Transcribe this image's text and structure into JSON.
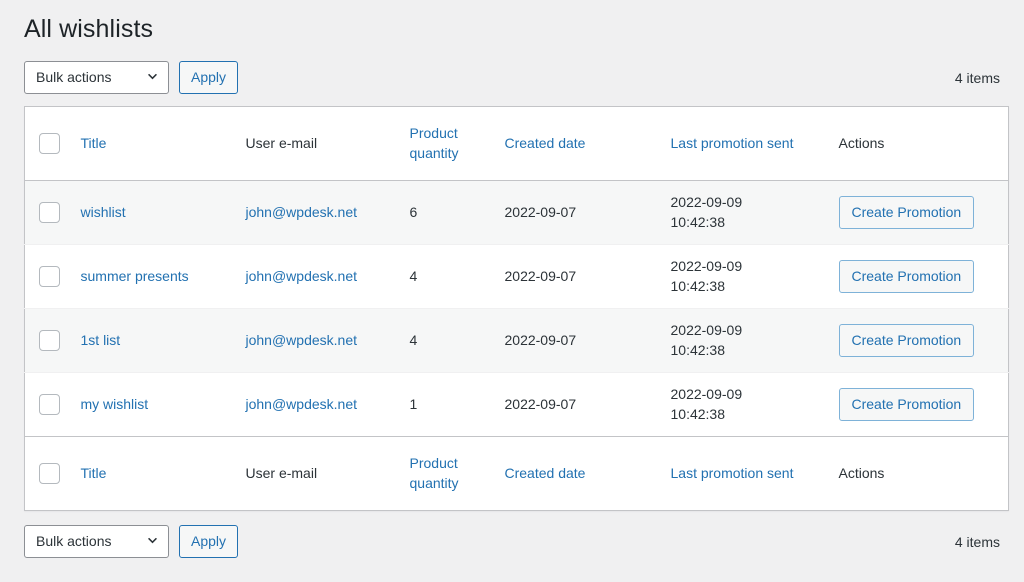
{
  "page": {
    "title": "All wishlists"
  },
  "tablenav": {
    "bulk_actions_label": "Bulk actions",
    "apply_label": "Apply",
    "items_count": "4 items",
    "chevron_icon": "chevron-down-icon"
  },
  "table": {
    "columns": [
      {
        "key": "cb",
        "label": "",
        "link": false
      },
      {
        "key": "title",
        "label": "Title",
        "link": true
      },
      {
        "key": "email",
        "label": "User e-mail",
        "link": false
      },
      {
        "key": "qty",
        "label": "Product quantity",
        "link": true
      },
      {
        "key": "date",
        "label": "Created date",
        "link": true
      },
      {
        "key": "promo",
        "label": "Last promotion sent",
        "link": true
      },
      {
        "key": "act",
        "label": "Actions",
        "link": false
      }
    ],
    "rows": [
      {
        "title": "wishlist",
        "email": "john@wpdesk.net",
        "qty": "6",
        "created_date": "2022-09-07",
        "promo_date": "2022-09-09",
        "promo_time": "10:42:38",
        "action_label": "Create Promotion"
      },
      {
        "title": "summer presents",
        "email": "john@wpdesk.net",
        "qty": "4",
        "created_date": "2022-09-07",
        "promo_date": "2022-09-09",
        "promo_time": "10:42:38",
        "action_label": "Create Promotion"
      },
      {
        "title": "1st list",
        "email": "john@wpdesk.net",
        "qty": "4",
        "created_date": "2022-09-07",
        "promo_date": "2022-09-09",
        "promo_time": "10:42:38",
        "action_label": "Create Promotion"
      },
      {
        "title": "my wishlist",
        "email": "john@wpdesk.net",
        "qty": "1",
        "created_date": "2022-09-07",
        "promo_date": "2022-09-09",
        "promo_time": "10:42:38",
        "action_label": "Create Promotion"
      }
    ]
  },
  "colors": {
    "link": "#2271b1",
    "text": "#2c3338",
    "page_background": "#f0f0f1",
    "table_border": "#c3c4c7",
    "alt_row": "#f6f7f7"
  }
}
